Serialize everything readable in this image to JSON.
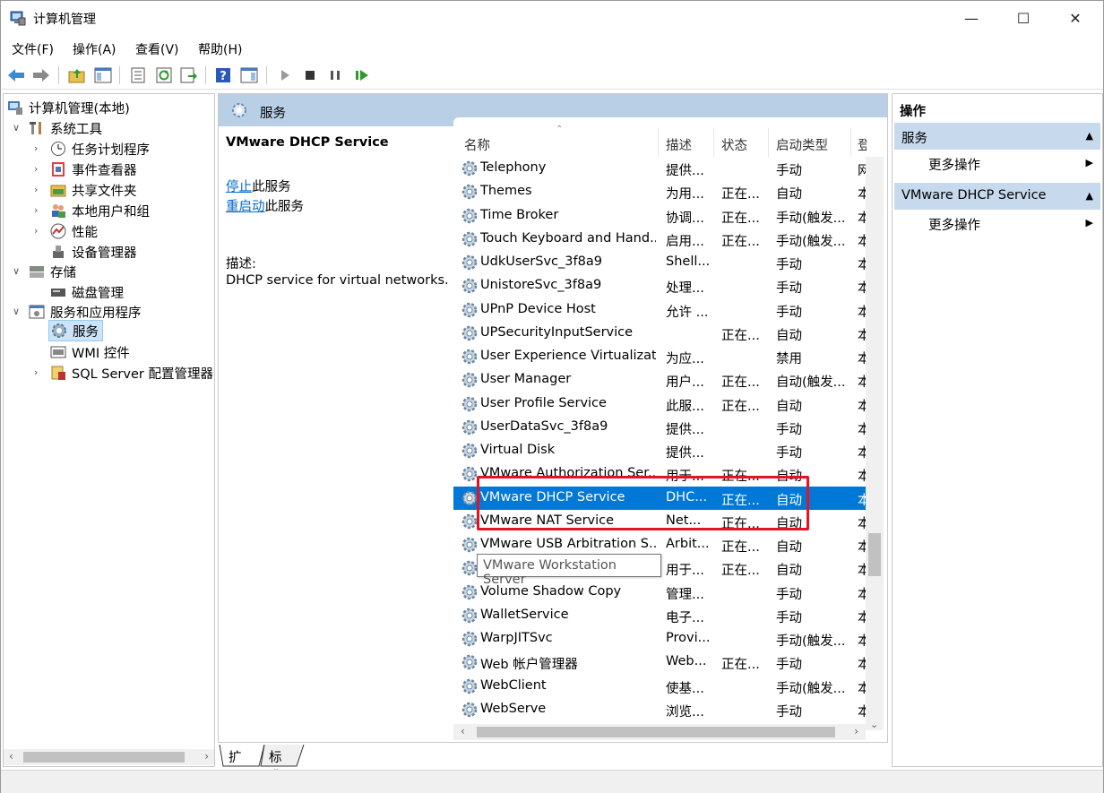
{
  "window": {
    "title": "计算机管理"
  },
  "menu": [
    "文件(F)",
    "操作(A)",
    "查看(V)",
    "帮助(H)"
  ],
  "tree": {
    "root": "计算机管理(本地)",
    "system_tools": "系统工具",
    "task_scheduler": "任务计划程序",
    "event_viewer": "事件查看器",
    "shared_folders": "共享文件夹",
    "local_users": "本地用户和组",
    "performance": "性能",
    "device_manager": "设备管理器",
    "storage": "存储",
    "disk_management": "磁盘管理",
    "services_apps": "服务和应用程序",
    "services": "服务",
    "wmi": "WMI 控件",
    "sql_server": "SQL Server 配置管理器"
  },
  "center": {
    "header_title": "服务",
    "selected_service": "VMware DHCP Service",
    "stop_link": "停止",
    "stop_suffix": "此服务",
    "restart_link": "重启动",
    "restart_suffix": "此服务",
    "desc_label": "描述:",
    "desc_text": "DHCP service for virtual networks."
  },
  "columns": [
    "名称",
    "描述",
    "状态",
    "启动类型",
    "登"
  ],
  "rows": [
    {
      "name": "Telephony",
      "desc": "提供...",
      "status": "",
      "startup": "手动",
      "logon": "网"
    },
    {
      "name": "Themes",
      "desc": "为用...",
      "status": "正在...",
      "startup": "自动",
      "logon": "本"
    },
    {
      "name": "Time Broker",
      "desc": "协调...",
      "status": "正在...",
      "startup": "手动(触发...",
      "logon": "本"
    },
    {
      "name": "Touch Keyboard and Hand...",
      "desc": "启用...",
      "status": "正在...",
      "startup": "手动(触发...",
      "logon": "本"
    },
    {
      "name": "UdkUserSvc_3f8a9",
      "desc": "Shell...",
      "status": "",
      "startup": "手动",
      "logon": "本"
    },
    {
      "name": "UnistoreSvc_3f8a9",
      "desc": "处理...",
      "status": "",
      "startup": "手动",
      "logon": "本"
    },
    {
      "name": "UPnP Device Host",
      "desc": "允许 ...",
      "status": "",
      "startup": "手动",
      "logon": "本"
    },
    {
      "name": "UPSecurityInputService",
      "desc": "",
      "status": "正在...",
      "startup": "自动",
      "logon": "本"
    },
    {
      "name": "User Experience Virtualizat...",
      "desc": "为应...",
      "status": "",
      "startup": "禁用",
      "logon": "本"
    },
    {
      "name": "User Manager",
      "desc": "用户...",
      "status": "正在...",
      "startup": "自动(触发...",
      "logon": "本"
    },
    {
      "name": "User Profile Service",
      "desc": "此服...",
      "status": "正在...",
      "startup": "自动",
      "logon": "本"
    },
    {
      "name": "UserDataSvc_3f8a9",
      "desc": "提供...",
      "status": "",
      "startup": "手动",
      "logon": "本"
    },
    {
      "name": "Virtual Disk",
      "desc": "提供...",
      "status": "",
      "startup": "手动",
      "logon": "本"
    },
    {
      "name": "VMware Authorization Ser...",
      "desc": "用于...",
      "status": "正在...",
      "startup": "自动",
      "logon": "本"
    },
    {
      "name": "VMware DHCP Service",
      "desc": "DHC...",
      "status": "正在...",
      "startup": "自动",
      "logon": "本"
    },
    {
      "name": "VMware NAT Service",
      "desc": "Net...",
      "status": "正在...",
      "startup": "自动",
      "logon": "本"
    },
    {
      "name": "VMware USB Arbitration S...",
      "desc": "Arbit...",
      "status": "正在...",
      "startup": "自动",
      "logon": "本"
    },
    {
      "name": "",
      "desc": "用于...",
      "status": "正在...",
      "startup": "自动",
      "logon": "本"
    },
    {
      "name": "Volume Shadow Copy",
      "desc": "管理...",
      "status": "",
      "startup": "手动",
      "logon": "本"
    },
    {
      "name": "WalletService",
      "desc": "电子...",
      "status": "",
      "startup": "手动",
      "logon": "本"
    },
    {
      "name": "WarpJITSvc",
      "desc": "Provi...",
      "status": "",
      "startup": "手动(触发...",
      "logon": "本"
    },
    {
      "name": "Web 帐户管理器",
      "desc": "Web...",
      "status": "正在...",
      "startup": "手动",
      "logon": "本"
    },
    {
      "name": "WebClient",
      "desc": "使基...",
      "status": "",
      "startup": "手动(触发...",
      "logon": "本"
    },
    {
      "name": "WebServe",
      "desc": "浏览...",
      "status": "",
      "startup": "手动",
      "logon": "本"
    }
  ],
  "tooltip": "VMware Workstation Server",
  "tabs": [
    "扩展",
    "标准"
  ],
  "actions": {
    "title": "操作",
    "section1": "服务",
    "more1": "更多操作",
    "section2": "VMware DHCP Service",
    "more2": "更多操作"
  },
  "colors": {
    "selection": "#0078d7",
    "highlight_box": "#e81123",
    "header_band": "#b9cfe6"
  }
}
